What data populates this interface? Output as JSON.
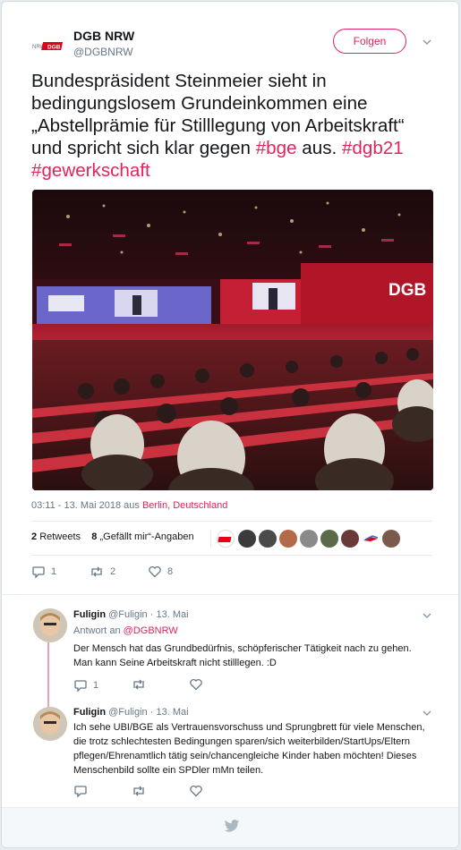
{
  "author": {
    "name": "DGB NRW",
    "handle": "@DGBNRW",
    "logo_text": "NRW DGB"
  },
  "follow_label": "Folgen",
  "tweet": {
    "text_plain": "Bundespräsident Steinmeier sieht in bedingungslosem Grundeinkommen eine „Abstellprämie für Stilllegung von Arbeitskraft“ und spricht sich klar gegen",
    "hashtag_1": "#bge",
    "connector": "aus.",
    "hashtag_2": "#dgb21",
    "hashtag_3": "#gewerkschaft",
    "photo_stage_text": "DGB"
  },
  "meta": {
    "time": "03:11 - 13. Mai 2018 aus",
    "location": "Berlin, Deutschland"
  },
  "stats": {
    "retweets_count": "2",
    "retweets_label": "Retweets",
    "likes_count": "8",
    "likes_label": "„Gefällt mir“-Angaben"
  },
  "actions": {
    "reply_count": "1",
    "retweet_count": "2",
    "like_count": "8"
  },
  "replies": [
    {
      "name": "Fuligin",
      "handle": "@Fuligin",
      "date": "· 13. Mai",
      "reply_to_label": "Antwort an",
      "reply_to_handle": "@DGBNRW",
      "text": "Der Mensch hat das Grundbedürfnis, schöpferischer Tätigkeit nach zu gehen. Man kann Seine Arbeitskraft nicht stilllegen. :D",
      "reply_count": "1"
    },
    {
      "name": "Fuligin",
      "handle": "@Fuligin",
      "date": "· 13. Mai",
      "text": "Ich sehe UBI/BGE als Vertrauensvorschuss und Sprungbrett für viele Menschen, die trotz schlechtesten Bedingungen sparen/sich weiterbilden/StartUps/Eltern pflegen/Ehrenamtlich tätig sein/chancengleiche Kinder haben möchten! Dieses Menschenbild sollte ein SPDler mMn teilen."
    }
  ],
  "colors": {
    "accent": "#e0245e",
    "muted": "#657786",
    "text": "#14171a"
  }
}
